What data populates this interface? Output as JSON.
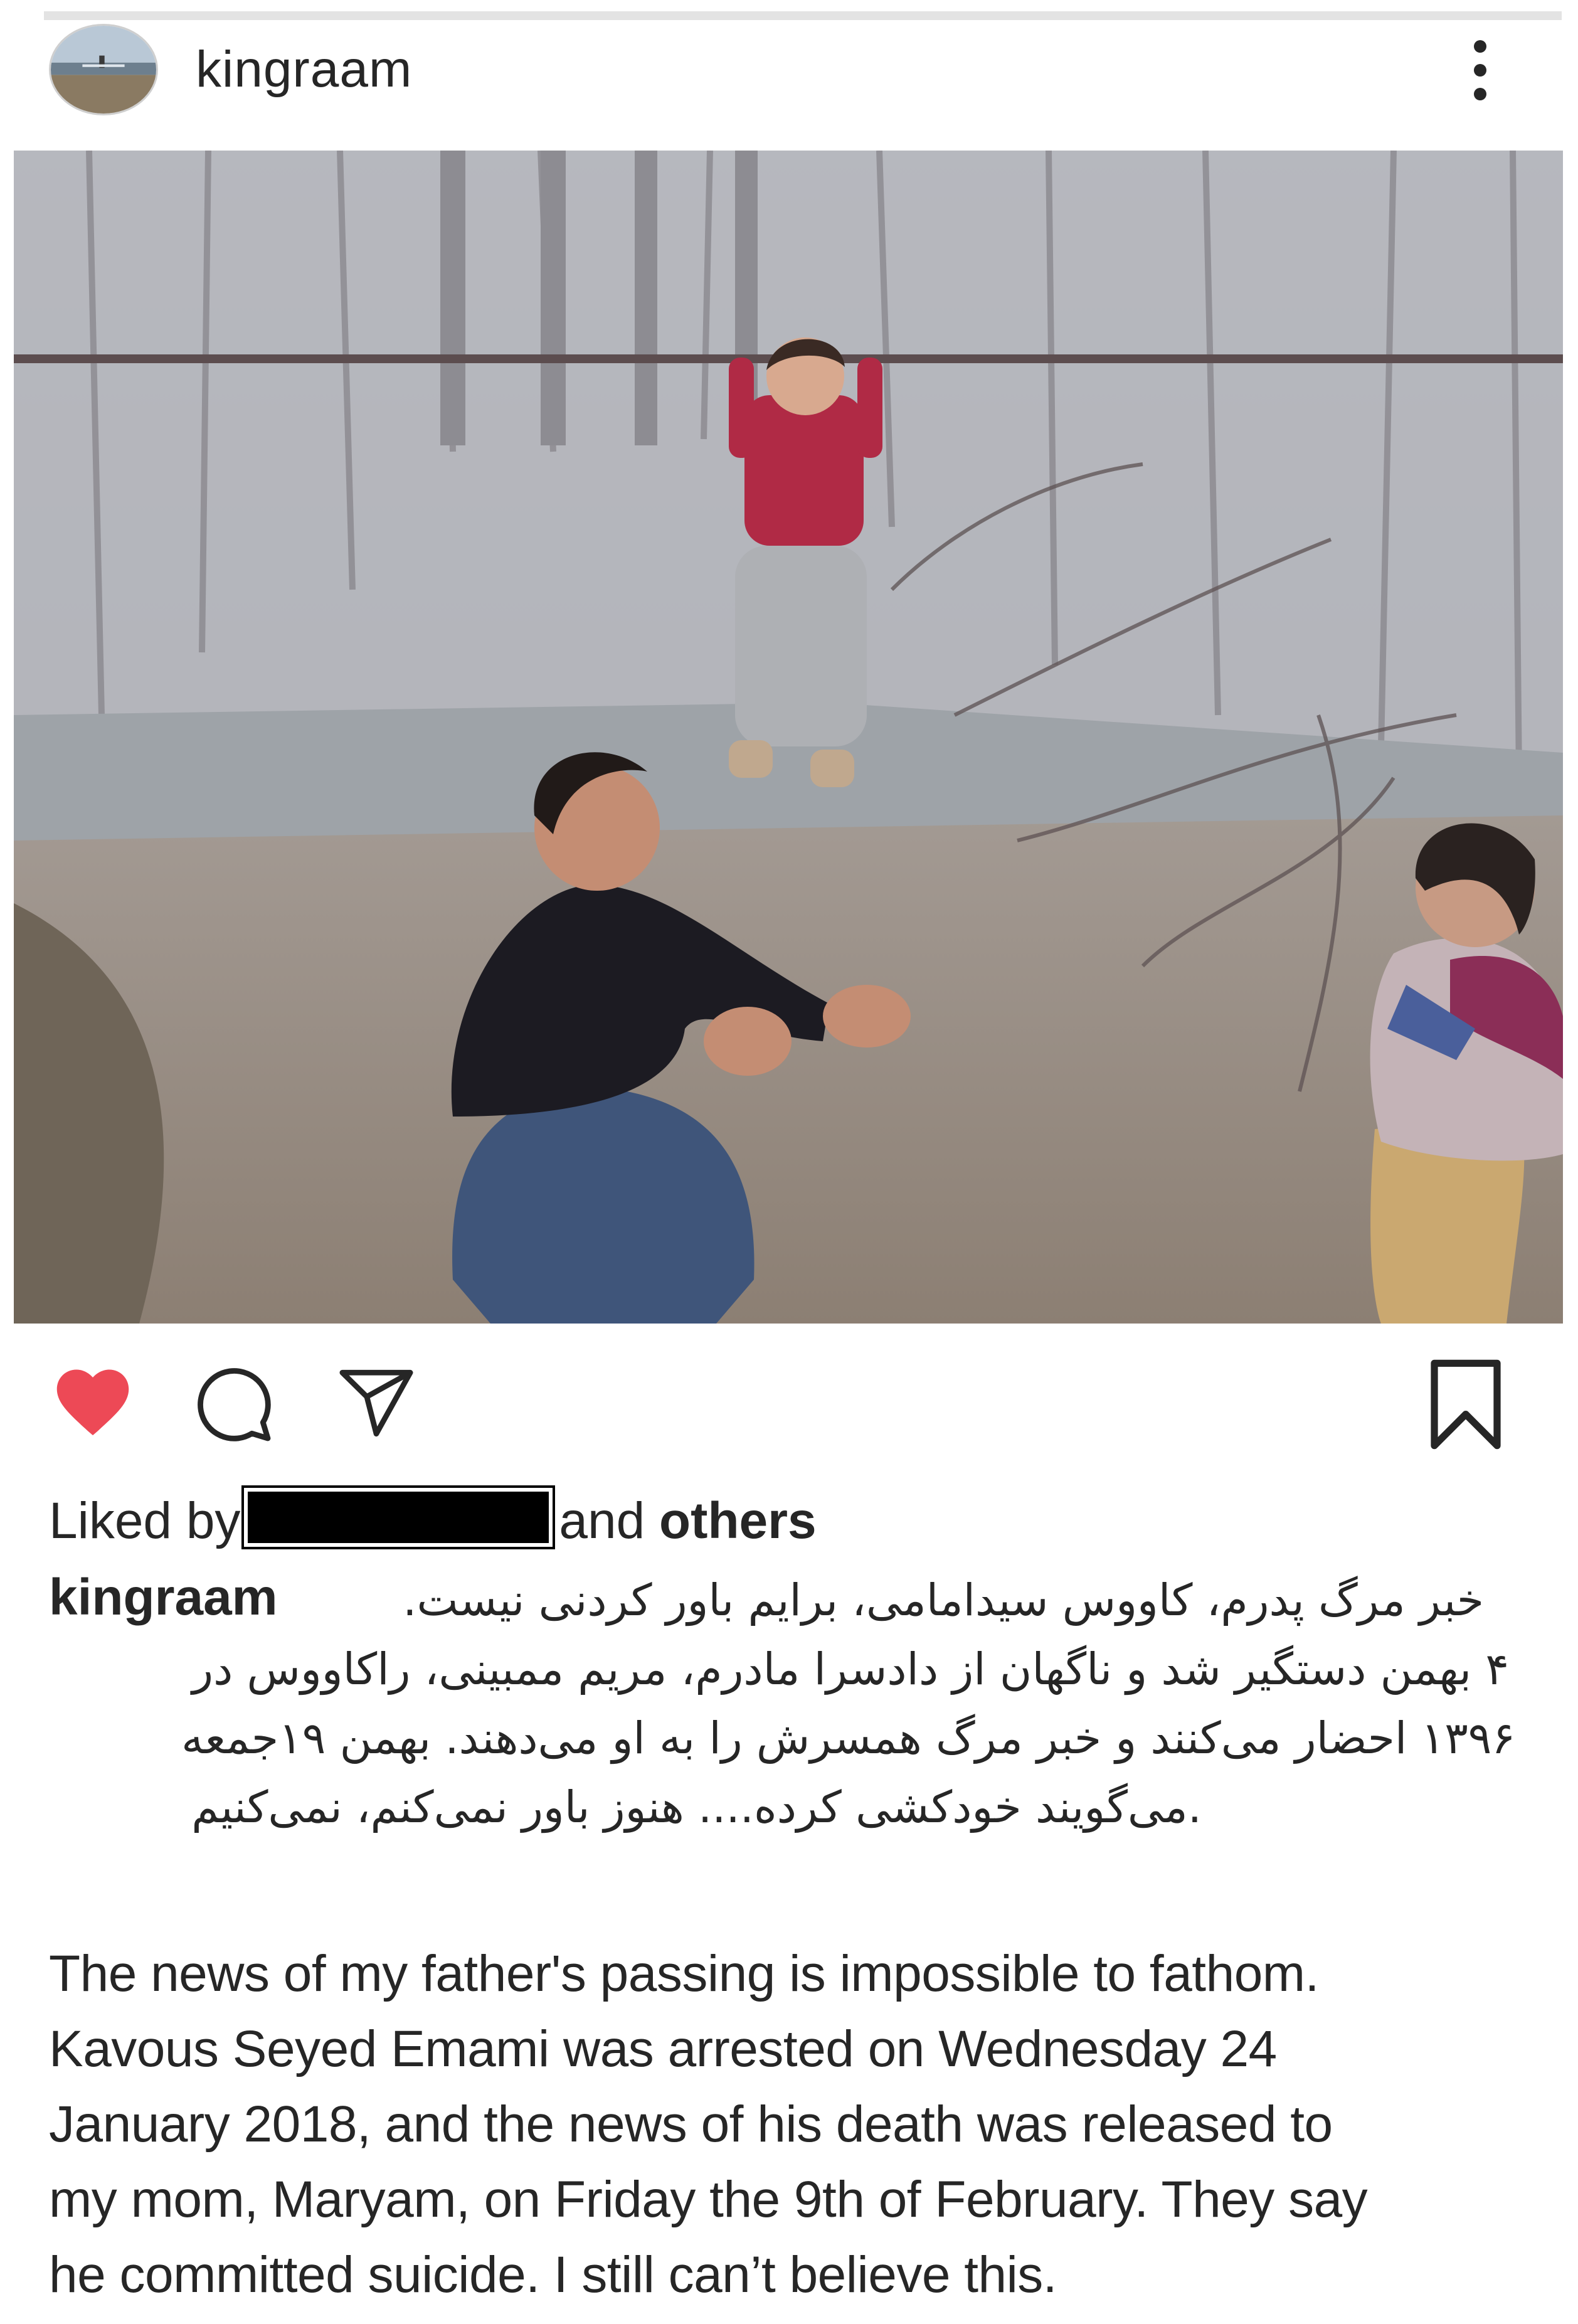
{
  "post": {
    "username": "kingraam",
    "liked_by_prefix": "Liked by",
    "liked_by_and": "and",
    "liked_by_others": "others"
  },
  "caption": {
    "username": "kingraam",
    "farsi_lines": [
      "خبر مرگ پدرم، کاووس سیدامامی، برایم باور کردنی نیست.",
      "۴ بهمن دستگیر شد و ناگهان از دادسرا مادرم، مریم ممبینی، راکاووس در",
      "۱۳۹۶ احضار می‌کنند و خبر مرگ همسرش را به او می‌دهند. بهمن ۱۹جمعه",
      ".می‌گویند خودکشی کرده.... هنوز باور نمی‌کنم، نمی‌کنیم"
    ],
    "english_lines": [
      "The news of my father's passing is impossible to fathom.",
      "Kavous Seyed Emami was arrested on Wednesday 24",
      "January 2018, and the news of his death was released to",
      "my mom, Maryam, on Friday the 9th of February. They say",
      "he committed suicide. I still can’t believe this."
    ]
  },
  "colors": {
    "like_active": "#ed4956",
    "text": "#262626"
  },
  "icons": {
    "more": "more-vertical-icon",
    "like": "heart-icon",
    "comment": "comment-icon",
    "share": "send-icon",
    "save": "bookmark-icon"
  }
}
